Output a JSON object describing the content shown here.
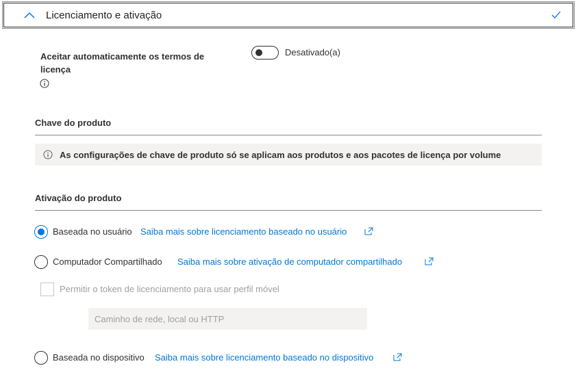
{
  "section": {
    "title": "Licenciamento e ativação"
  },
  "accept_terms": {
    "label": "Aceitar automaticamente os termos de licença",
    "toggle_state": "Desativado(a)",
    "toggle_on": false
  },
  "product_key": {
    "title": "Chave do produto",
    "info": "As configurações de chave de produto só se aplicam aos produtos e aos pacotes de licença por volume"
  },
  "activation": {
    "title": "Ativação do produto",
    "options": [
      {
        "label": "Baseada no usuário",
        "link": "Saiba mais sobre licenciamento baseado no usuário",
        "checked": true
      },
      {
        "label": "Computador Compartilhado",
        "link": "Saiba mais sobre ativação de computador compartilhado",
        "checked": false
      },
      {
        "label": "Baseada no dispositivo",
        "link": "Saiba mais sobre licenciamento baseado no dispositivo",
        "checked": false
      }
    ],
    "roaming_checkbox_label": "Permitir o token de licenciamento para usar perfil móvel",
    "roaming_checkbox_enabled": false,
    "path_placeholder": "Caminho de rede, local ou HTTP"
  },
  "colors": {
    "accent": "#0078d4",
    "text": "#323130",
    "disabled_text": "#a19f9d",
    "infobar_bg": "#f3f2f1"
  }
}
